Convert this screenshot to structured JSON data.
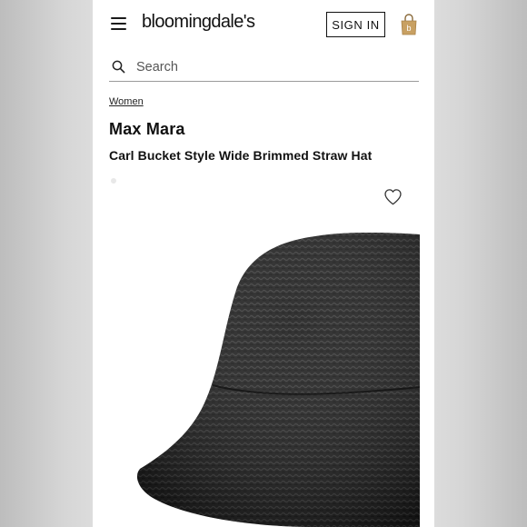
{
  "header": {
    "logo_text": "bloomingdale's",
    "signin_label": "SIGN IN",
    "bag_letter": "b"
  },
  "search": {
    "placeholder": "Search"
  },
  "breadcrumb": {
    "label": "Women"
  },
  "product": {
    "brand": "Max Mara",
    "title": "Carl Bucket Style Wide Brimmed Straw Hat"
  },
  "colors": {
    "accent_bag": "#c8a062",
    "hat": "#1b1b1b",
    "text": "#111111"
  },
  "icons": {
    "menu": "hamburger-menu-icon",
    "search": "search-icon",
    "bag": "shopping-bag-icon",
    "favorite": "heart-icon"
  }
}
